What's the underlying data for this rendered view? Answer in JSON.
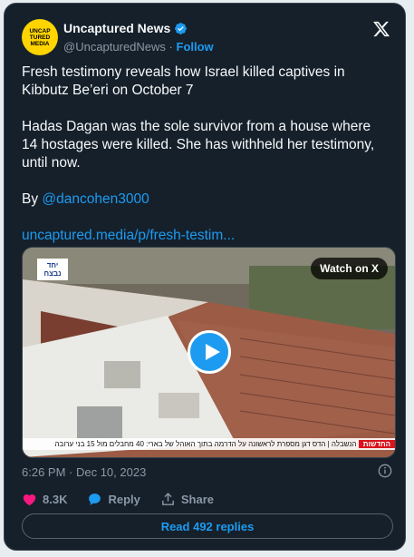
{
  "author": {
    "avatar_lines": [
      "UNCAP",
      "TURED",
      "MEDIA"
    ],
    "name": "Uncaptured News",
    "handle": "@UncapturedNews",
    "separator": "·",
    "follow_label": "Follow"
  },
  "tweet": {
    "paragraph1": "Fresh testimony reveals how Israel killed captives in Kibbutz Be’eri on October 7",
    "paragraph2": "Hadas Dagan was the sole survivor from a house where 14 hostages were killed. She has withheld her testimony, until now.",
    "by_prefix": "By ",
    "mention": "@dancohen3000",
    "link": "uncaptured.media/p/fresh-testim..."
  },
  "media": {
    "watch_label": "Watch on X",
    "channel_logo_lines": [
      "יחד",
      "נבצח"
    ],
    "ticker_brand": "החדשות",
    "ticker_text": "הנשבלה | הדס דגן מספרת לראשונה על הדרמה בתוך האוהל של בארי: 40 מחבלים מול 15 בני ערובה"
  },
  "timestamp": "6:26 PM · Dec 10, 2023",
  "actions": {
    "likes": "8.3K",
    "reply_label": "Reply",
    "share_label": "Share"
  },
  "replies_button": "Read 492 replies",
  "colors": {
    "background": "#15202b",
    "accent": "#1d9bf0",
    "like": "#f91880",
    "verified_badge": "#1d9bf0"
  }
}
